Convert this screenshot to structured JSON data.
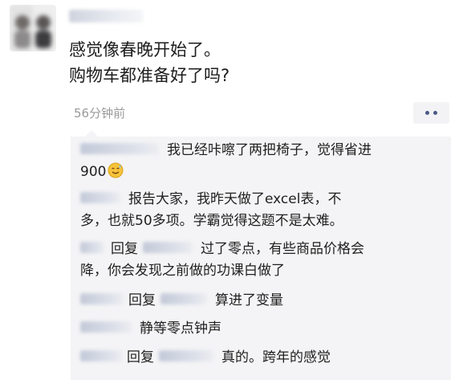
{
  "post": {
    "lines": [
      "感觉像春晚开始了。",
      "购物车都准备好了吗?"
    ],
    "timestamp": "56分钟前"
  },
  "comments": [
    {
      "lines": [
        "我已经咔嚓了两把椅子，觉得省进",
        "900"
      ],
      "emoji": "smiling-face-with-sweat-icon"
    },
    {
      "lines": [
        "报告大家，我昨天做了excel表，不",
        "多，也就50多项。学霸觉得这题不是太难。"
      ]
    },
    {
      "reply": "回复",
      "lines": [
        "过了零点，有些商品价格会",
        "降，你会发现之前做的功课白做了"
      ]
    },
    {
      "reply": "回复",
      "lines": [
        "算进了变量"
      ]
    },
    {
      "lines": [
        "静等零点钟声"
      ]
    },
    {
      "reply": "回复",
      "lines": [
        "真的。跨年的感觉"
      ]
    }
  ],
  "colors": {
    "comment_background": "#f4f4f6",
    "more_button_dots": "#4a5a85",
    "timestamp_gray": "#9a9a9a"
  }
}
